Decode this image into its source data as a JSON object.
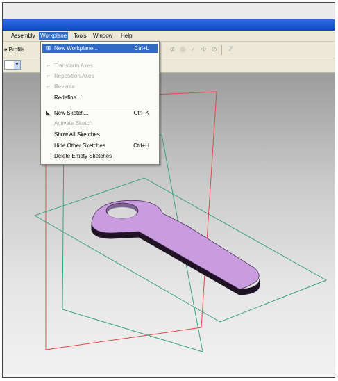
{
  "menubar": {
    "items": [
      "Assembly",
      "Workplane",
      "Tools",
      "Window",
      "Help"
    ],
    "active": "Workplane"
  },
  "toolbar": {
    "profile_label": "e Profile"
  },
  "workplane_menu": {
    "items": [
      {
        "label": "New Workplane...",
        "shortcut": "Ctrl+L",
        "state": "highlighted",
        "icon": "new-workplane-icon"
      },
      {
        "label": "Transform Axes...",
        "shortcut": "",
        "state": "disabled",
        "icon": "transform-axes-icon"
      },
      {
        "label": "Reposition Axes",
        "shortcut": "",
        "state": "disabled",
        "icon": "reposition-axes-icon"
      },
      {
        "label": "Reverse",
        "shortcut": "",
        "state": "disabled",
        "icon": "reverse-icon"
      },
      {
        "label": "Redefine...",
        "shortcut": "",
        "state": "enabled",
        "icon": ""
      },
      {
        "label": "New Sketch...",
        "shortcut": "Ctrl+K",
        "state": "enabled",
        "icon": "new-sketch-icon"
      },
      {
        "label": "Activate Sketch",
        "shortcut": "",
        "state": "disabled",
        "icon": ""
      },
      {
        "label": "Show All Sketches",
        "shortcut": "",
        "state": "enabled",
        "icon": ""
      },
      {
        "label": "Hide Other Sketches",
        "shortcut": "Ctrl+H",
        "state": "enabled",
        "icon": ""
      },
      {
        "label": "Delete Empty Sketches",
        "shortcut": "",
        "state": "enabled",
        "icon": ""
      }
    ]
  },
  "colors": {
    "titlebar": "#1a55d0",
    "menu_highlight": "#316ac5",
    "key_fill": "#c99ce0",
    "key_side": "#1e1224",
    "plane_red": "#e04848",
    "plane_green": "#3aa07f"
  }
}
